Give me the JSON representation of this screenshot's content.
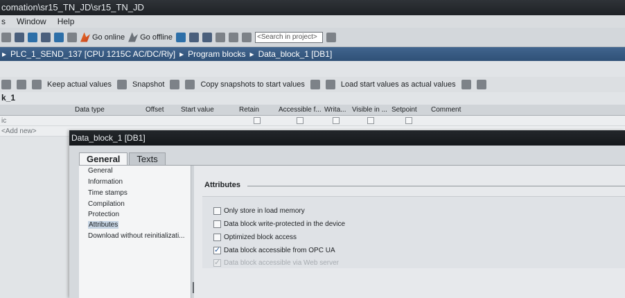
{
  "window": {
    "title": "comation\\sr15_TN_JD\\sr15_TN_JD"
  },
  "menu": {
    "items": [
      "s",
      "Window",
      "Help"
    ]
  },
  "toolbar": {
    "go_online": "Go online",
    "go_offline": "Go offline",
    "search_placeholder": "<Search in project>"
  },
  "breadcrumb": {
    "arrow": "▸",
    "parts": [
      "PLC_1_SEND_137 [CPU 1215C AC/DC/Rly]",
      "Program blocks",
      "Data_block_1 [DB1]"
    ]
  },
  "editor": {
    "toolbar": {
      "keep_actual": "Keep actual values",
      "snapshot": "Snapshot",
      "copy_snapshots": "Copy snapshots to start values",
      "load_start": "Load start values as actual values"
    },
    "block_title": "k_1",
    "columns": [
      "Data type",
      "Offset",
      "Start value",
      "Retain",
      "Accessible f...",
      "Writa...",
      "Visible in ...",
      "Setpoint",
      "Comment"
    ],
    "rows": [
      "ic",
      "<Add new>"
    ]
  },
  "dialog": {
    "title": "Data_block_1 [DB1]",
    "tabs": [
      "General",
      "Texts"
    ],
    "nav": [
      "General",
      "Information",
      "Time stamps",
      "Compilation",
      "Protection",
      "Attributes",
      "Download without reinitializati..."
    ],
    "section_title": "Attributes",
    "options": [
      {
        "label": "Only store in load memory",
        "checked": false,
        "enabled": true
      },
      {
        "label": "Data block write-protected in the device",
        "checked": false,
        "enabled": true
      },
      {
        "label": "Optimized block access",
        "checked": false,
        "enabled": true
      },
      {
        "label": "Data block accessible from OPC UA",
        "checked": true,
        "enabled": true
      },
      {
        "label": "Data block accessible via Web server",
        "checked": true,
        "enabled": false
      }
    ]
  }
}
